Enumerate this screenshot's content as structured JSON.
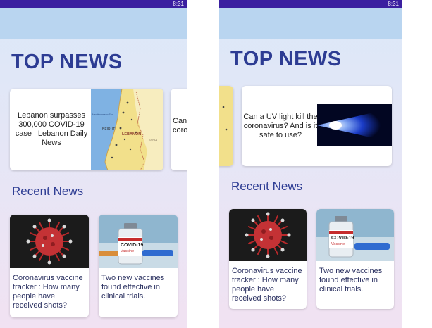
{
  "status": {
    "time": "8:31"
  },
  "top_news_title": "TOP NEWS",
  "recent_news_title": "Recent News",
  "left_screen": {
    "carousel": [
      {
        "title": "Lebanon surpasses 300,000 COVID-19 case | Lebanon Daily News",
        "image": "lebanon-map"
      },
      {
        "title_partial": "Can\ncoro"
      }
    ],
    "recent": [
      {
        "title": "Coronavirus vaccine tracker : How many people have received shots?",
        "image": "coronavirus-illustration"
      },
      {
        "title": "Two new vaccines found effective in clinical trials.",
        "image": "covid-vaccine-vial"
      }
    ]
  },
  "right_screen": {
    "carousel": [
      {
        "title": "Can a UV light kill the coronavirus? And is it safe to use?",
        "image": "uv-light-beam"
      }
    ],
    "recent": [
      {
        "title": "Coronavirus vaccine tracker : How many people have received shots?",
        "image": "coronavirus-illustration"
      },
      {
        "title": "Two new vaccines found effective in clinical trials.",
        "image": "covid-vaccine-vial"
      }
    ]
  },
  "map_labels": {
    "country": "LEBANON",
    "city": "BEIRUT",
    "sea": "Mediterranean Sea",
    "neighbor": "SYRIA"
  },
  "vial_labels": {
    "line1": "COVID-19",
    "line2": "Vaccine"
  },
  "colors": {
    "accent": "#2d3c93",
    "statusbar": "#3b1fa0",
    "appbar": "#b9d5f0"
  }
}
